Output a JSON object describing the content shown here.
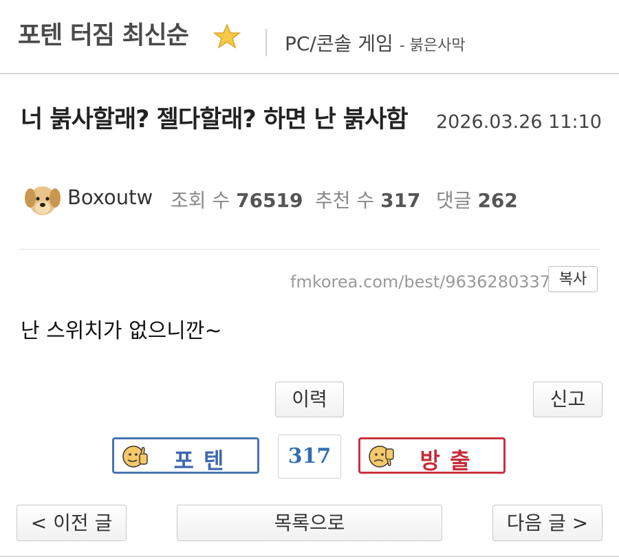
{
  "header": {
    "board_title": "포텐 터짐 최신순",
    "board_icon": "star-icon",
    "category": "PC/콘솔 게임",
    "subcategory": "- 붉은사막"
  },
  "post": {
    "title": "너 붉사할래? 젤다할래? 하면 난 붉사함",
    "date": "2026.03.26 11:10",
    "author": "Boxoutw",
    "avatar_icon": "puppy-avatar",
    "views_label": "조회 수",
    "views": "76519",
    "recommends_label": "추천 수",
    "recommends": "317",
    "comments_label": "댓글",
    "comments": "262",
    "url": "fmkorea.com/best/9636280337",
    "copy_label": "복사",
    "content": "난 스위치가 없으니깐~"
  },
  "actions": {
    "history_label": "이력",
    "report_label": "신고",
    "vote_up_label": "포텐",
    "vote_count": "317",
    "vote_down_label": "방출",
    "vote_up_color": "#3d67b0",
    "vote_down_color": "#c62a36"
  },
  "nav": {
    "prev_label": "< 이전 글",
    "list_label": "목록으로",
    "next_label": "다음 글 >"
  }
}
